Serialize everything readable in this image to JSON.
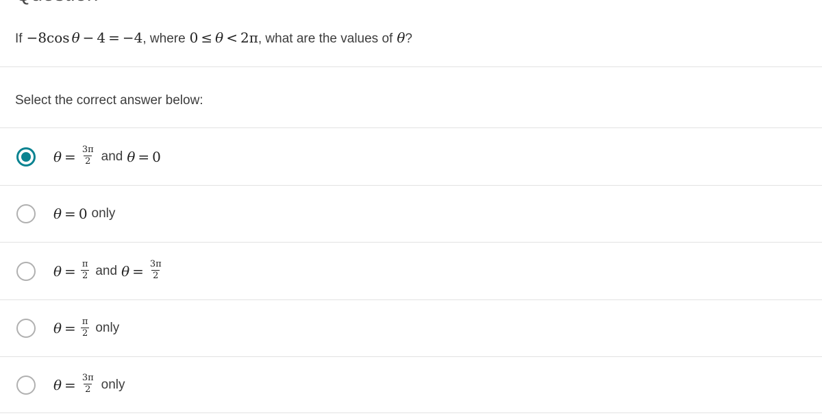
{
  "header": {
    "title": "Question"
  },
  "prompt": {
    "lead": "If",
    "expression": "−8cos θ − 4 = −4",
    "middle": ", where",
    "domain": "0 ≤ θ < 2π",
    "tail": ", what are the values of",
    "variable": "θ",
    "question_mark": "?",
    "parts": {
      "neg8cos": "−8cos",
      "theta": "θ",
      "minus": "−",
      "four": "4",
      "equals": "=",
      "neg4": "−4",
      "comma_where": ", where",
      "zero": "0",
      "leq": "≤",
      "lt": "<",
      "twopi": "2π",
      "comma_what": ", what are the values of"
    }
  },
  "instruction": {
    "text": "Select the correct answer below:"
  },
  "colors": {
    "accent": "#0a8391",
    "text": "#3c3c3c",
    "math": "#222222",
    "divider": "#e2e2e2",
    "radio_border": "#b0b0b0",
    "background": "#ffffff"
  },
  "options": [
    {
      "id": "option-1",
      "selected": true,
      "text": "θ = 3π/2 and θ = 0",
      "theta": "θ",
      "equals": "=",
      "frac1_num": "3π",
      "frac1_den": "2",
      "conjunction": "and",
      "theta2": "θ",
      "equals2": "=",
      "value2": "0"
    },
    {
      "id": "option-2",
      "selected": false,
      "text": "θ = 0 only",
      "theta": "θ",
      "equals": "=",
      "value": "0",
      "suffix": "only"
    },
    {
      "id": "option-3",
      "selected": false,
      "text": "θ = π/2 and θ = 3π/2",
      "theta": "θ",
      "equals": "=",
      "frac1_num": "π",
      "frac1_den": "2",
      "conjunction": "and",
      "theta2": "θ",
      "equals2": "=",
      "frac2_num": "3π",
      "frac2_den": "2"
    },
    {
      "id": "option-4",
      "selected": false,
      "text": "θ = π/2 only",
      "theta": "θ",
      "equals": "=",
      "frac1_num": "π",
      "frac1_den": "2",
      "suffix": "only"
    },
    {
      "id": "option-5",
      "selected": false,
      "text": "θ = 3π/2 only",
      "theta": "θ",
      "equals": "=",
      "frac1_num": "3π",
      "frac1_den": "2",
      "suffix": "only"
    }
  ]
}
